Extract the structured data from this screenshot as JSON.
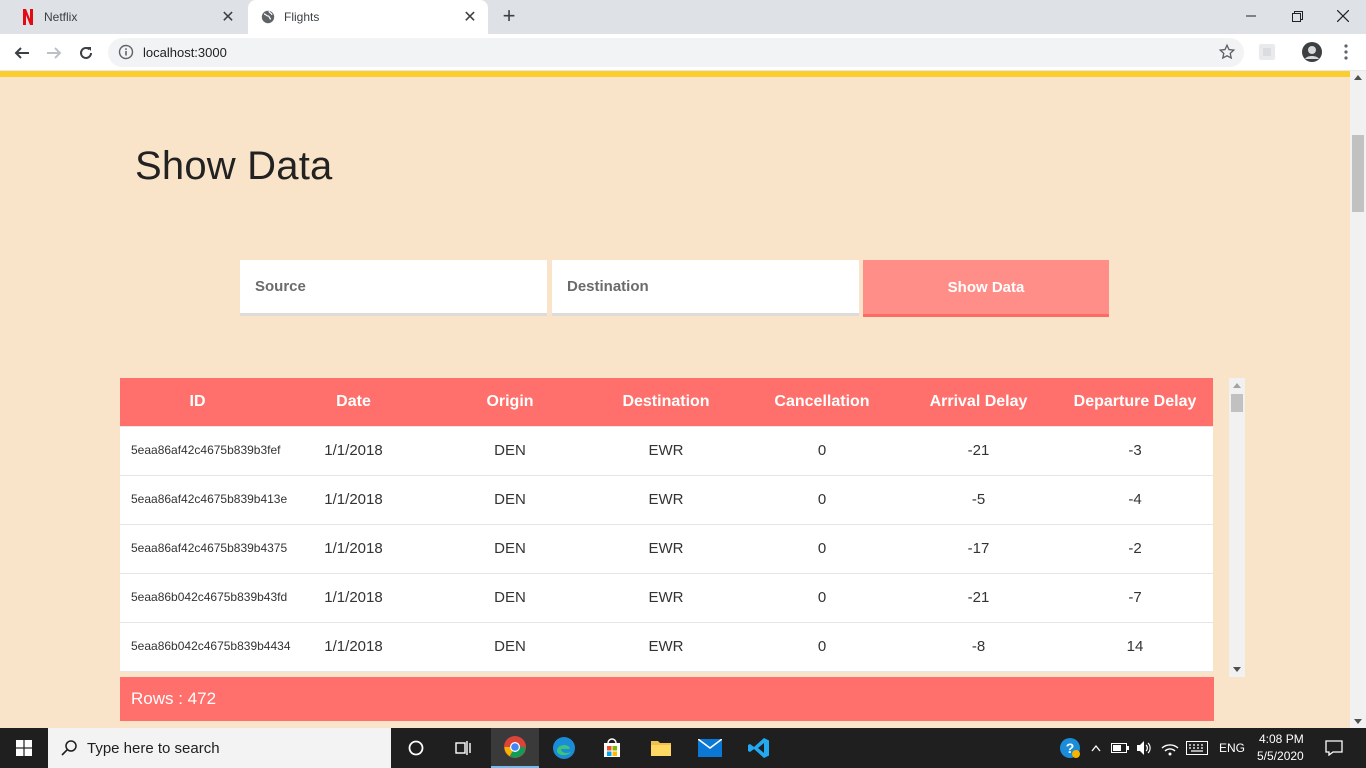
{
  "browser": {
    "tabs": [
      {
        "title": "Netflix",
        "icon": "netflix-icon"
      },
      {
        "title": "Flights",
        "icon": "globe-icon"
      }
    ],
    "url": "localhost:3000"
  },
  "page": {
    "title": "Show Data",
    "source_placeholder": "Source",
    "destination_placeholder": "Destination",
    "show_button_label": "Show Data"
  },
  "table": {
    "columns": [
      "ID",
      "Date",
      "Origin",
      "Destination",
      "Cancellation",
      "Arrival Delay",
      "Departure Delay"
    ],
    "rows": [
      [
        "5eaa86af42c4675b839b3fef",
        "1/1/2018",
        "DEN",
        "EWR",
        "0",
        "-21",
        "-3"
      ],
      [
        "5eaa86af42c4675b839b413e",
        "1/1/2018",
        "DEN",
        "EWR",
        "0",
        "-5",
        "-4"
      ],
      [
        "5eaa86af42c4675b839b4375",
        "1/1/2018",
        "DEN",
        "EWR",
        "0",
        "-17",
        "-2"
      ],
      [
        "5eaa86b042c4675b839b43fd",
        "1/1/2018",
        "DEN",
        "EWR",
        "0",
        "-21",
        "-7"
      ],
      [
        "5eaa86b042c4675b839b4434",
        "1/1/2018",
        "DEN",
        "EWR",
        "0",
        "-8",
        "14"
      ],
      [
        "",
        "",
        "",
        "",
        "",
        "",
        ""
      ]
    ],
    "footer": "Rows : 472"
  },
  "taskbar": {
    "search_placeholder": "Type here to search",
    "language": "ENG",
    "time": "4:08 PM",
    "date": "5/5/2020"
  },
  "colors": {
    "page_background": "#fae4c9",
    "accent_strip": "#fbce2d",
    "header_coral": "#ff6f6b",
    "button_coral": "#ff8e89"
  }
}
